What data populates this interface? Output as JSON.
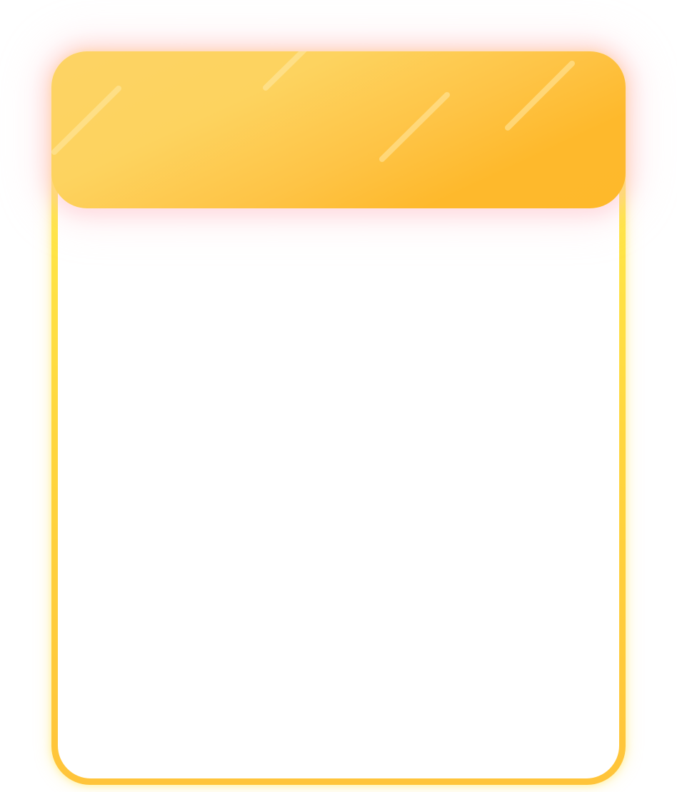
{
  "card": {
    "border_colors": [
      "#fff24d",
      "#ffd53d",
      "#ffc43a"
    ],
    "background": "#ffffff"
  },
  "header": {
    "gradient_colors": [
      "#fdd364",
      "#feb92b"
    ],
    "glow_color": "#ffb9c3",
    "streak_color": "#ffe9a6"
  }
}
